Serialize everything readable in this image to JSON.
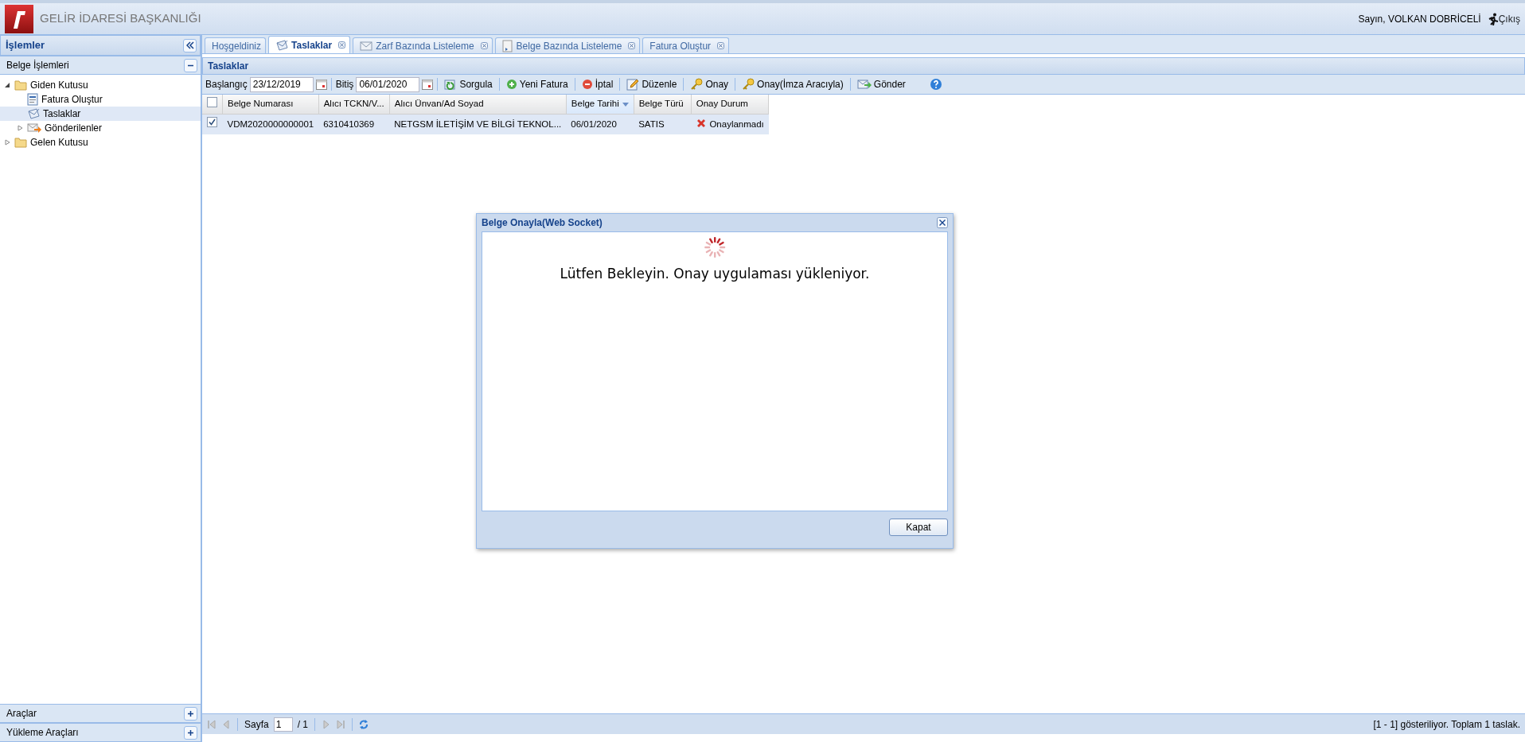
{
  "header": {
    "title": "GELİR İDARESİ BAŞKANLIĞI",
    "greeting": "Sayın, VOLKAN DOBRİCELİ",
    "logout": "Çıkış"
  },
  "sidebar": {
    "title": "İşlemler",
    "sections": [
      {
        "title": "Belge İşlemleri",
        "expanded": true,
        "tree": [
          {
            "label": "Giden Kutusu",
            "kind": "folder",
            "expanded": true,
            "selected": false,
            "children": [
              {
                "label": "Fatura Oluştur",
                "kind": "form",
                "selected": false
              },
              {
                "label": "Taslaklar",
                "kind": "draft",
                "selected": true
              },
              {
                "label": "Gönderilenler",
                "kind": "sent",
                "expanded": false,
                "selected": false
              }
            ]
          },
          {
            "label": "Gelen Kutusu",
            "kind": "folder",
            "expanded": false,
            "selected": false
          }
        ]
      }
    ],
    "bottom_sections": [
      {
        "title": "Araçlar",
        "expanded": false
      },
      {
        "title": "Yükleme Araçları",
        "expanded": false
      }
    ]
  },
  "tabs": [
    {
      "label": "Hoşgeldiniz",
      "kind": "plain",
      "selected": false,
      "closable": false
    },
    {
      "label": "Taslaklar",
      "kind": "draft",
      "selected": true,
      "closable": true
    },
    {
      "label": "Zarf Bazında Listeleme",
      "kind": "envelope",
      "selected": false,
      "closable": true
    },
    {
      "label": "Belge Bazında Listeleme",
      "kind": "document",
      "selected": false,
      "closable": true
    },
    {
      "label": "Fatura Oluştur",
      "kind": "plain",
      "selected": false,
      "closable": true
    }
  ],
  "panel": {
    "title": "Taslaklar",
    "toolbar": {
      "start_label": "Başlangıç",
      "start_value": "23/12/2019",
      "end_label": "Bitiş",
      "end_value": "06/01/2020",
      "buttons": [
        {
          "label": "Sorgula",
          "kind": "refresh"
        },
        {
          "label": "Yeni Fatura",
          "kind": "add"
        },
        {
          "label": "İptal",
          "kind": "remove"
        },
        {
          "label": "Düzenle",
          "kind": "edit"
        },
        {
          "label": "Onay",
          "kind": "key"
        },
        {
          "label": "Onay(İmza Aracıyla)",
          "kind": "key"
        },
        {
          "label": "Gönder",
          "kind": "send"
        }
      ]
    },
    "grid": {
      "all_checked": false,
      "columns": [
        {
          "label": "Belge Numarası",
          "sorted": false
        },
        {
          "label": "Alıcı TCKN/V...",
          "sorted": false
        },
        {
          "label": "Alıcı Ünvan/Ad Soyad",
          "sorted": false
        },
        {
          "label": "Belge Tarihi",
          "sorted": true
        },
        {
          "label": "Belge Türü",
          "sorted": false
        },
        {
          "label": "Onay Durum",
          "sorted": false
        }
      ],
      "rows": [
        {
          "checked": true,
          "selected": true,
          "cells": [
            "VDM2020000000001",
            "6310410369",
            "NETGSM İLETİŞİM VE BİLGİ TEKNOL...",
            "06/01/2020",
            "SATIS",
            "Onaylanmadı"
          ]
        }
      ]
    },
    "pager": {
      "page_label": "Sayfa",
      "page_value": "1",
      "page_total": "/ 1",
      "summary": "[1 - 1] gösteriliyor. Toplam 1 taslak."
    }
  },
  "dialog": {
    "title": "Belge Onayla(Web Socket)",
    "message": "Lütfen Bekleyin. Onay uygulaması yükleniyor.",
    "button": "Kapat"
  }
}
